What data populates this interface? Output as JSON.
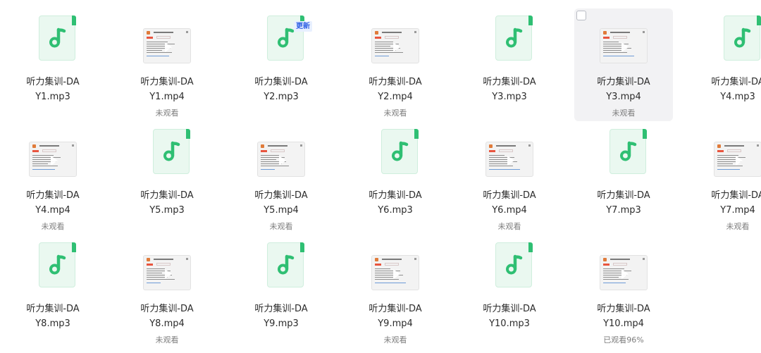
{
  "files": [
    {
      "line1": "听力集训-DA",
      "line2": "Y1.mp3",
      "kind": "audio",
      "status": "",
      "badge": ""
    },
    {
      "line1": "听力集训-DA",
      "line2": "Y1.mp4",
      "kind": "video",
      "status": "未观看",
      "badge": ""
    },
    {
      "line1": "听力集训-DA",
      "line2": "Y2.mp3",
      "kind": "audio",
      "status": "",
      "badge": "更新"
    },
    {
      "line1": "听力集训-DA",
      "line2": "Y2.mp4",
      "kind": "video",
      "status": "未观看",
      "badge": ""
    },
    {
      "line1": "听力集训-DA",
      "line2": "Y3.mp3",
      "kind": "audio",
      "status": "",
      "badge": ""
    },
    {
      "line1": "听力集训-DA",
      "line2": "Y3.mp4",
      "kind": "video",
      "status": "未观看",
      "badge": "",
      "hovered": true
    },
    {
      "line1": "听力集训-DA",
      "line2": "Y4.mp3",
      "kind": "audio",
      "status": "",
      "badge": ""
    },
    {
      "line1": "听力集训-DA",
      "line2": "Y4.mp4",
      "kind": "video",
      "status": "未观看",
      "badge": ""
    },
    {
      "line1": "听力集训-DA",
      "line2": "Y5.mp3",
      "kind": "audio",
      "status": "",
      "badge": ""
    },
    {
      "line1": "听力集训-DA",
      "line2": "Y5.mp4",
      "kind": "video",
      "status": "未观看",
      "badge": ""
    },
    {
      "line1": "听力集训-DA",
      "line2": "Y6.mp3",
      "kind": "audio",
      "status": "",
      "badge": ""
    },
    {
      "line1": "听力集训-DA",
      "line2": "Y6.mp4",
      "kind": "video",
      "status": "未观看",
      "badge": ""
    },
    {
      "line1": "听力集训-DA",
      "line2": "Y7.mp3",
      "kind": "audio",
      "status": "",
      "badge": ""
    },
    {
      "line1": "听力集训-DA",
      "line2": "Y7.mp4",
      "kind": "video",
      "status": "未观看",
      "badge": ""
    },
    {
      "line1": "听力集训-DA",
      "line2": "Y8.mp3",
      "kind": "audio",
      "status": "",
      "badge": ""
    },
    {
      "line1": "听力集训-DA",
      "line2": "Y8.mp4",
      "kind": "video",
      "status": "未观看",
      "badge": ""
    },
    {
      "line1": "听力集训-DA",
      "line2": "Y9.mp3",
      "kind": "audio",
      "status": "",
      "badge": ""
    },
    {
      "line1": "听力集训-DA",
      "line2": "Y9.mp4",
      "kind": "video",
      "status": "未观看",
      "badge": ""
    },
    {
      "line1": "听力集训-DA",
      "line2": "Y10.mp3",
      "kind": "audio",
      "status": "",
      "badge": ""
    },
    {
      "line1": "听力集训-DA",
      "line2": "Y10.mp4",
      "kind": "video",
      "status": "已观看96%",
      "badge": ""
    }
  ],
  "icons": {
    "audio": "music-note-file-icon",
    "video": "video-thumbnail",
    "play": "play-icon"
  },
  "colors": {
    "accent_green": "#2fbf73",
    "badge_blue": "#3162e4",
    "muted_text": "#7d7d7d"
  }
}
